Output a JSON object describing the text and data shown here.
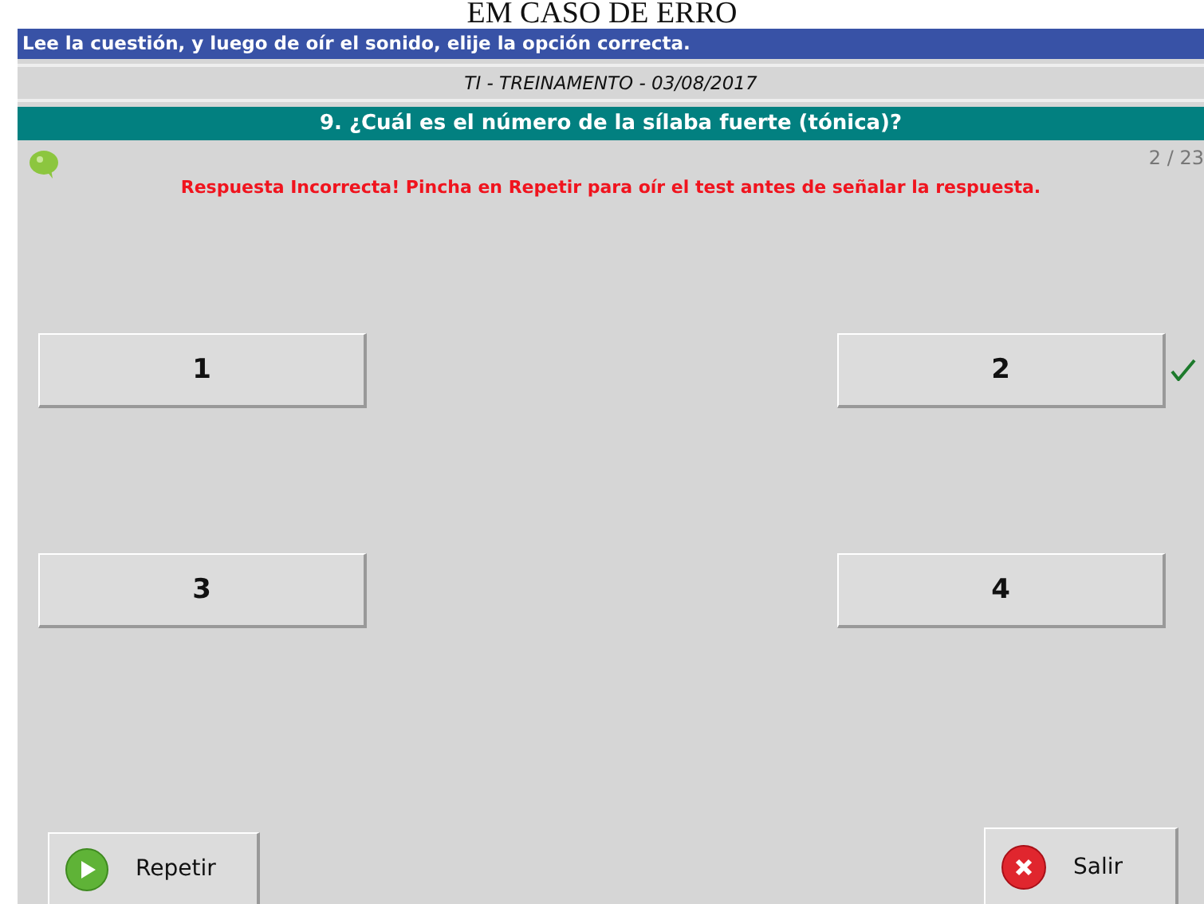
{
  "caption": "EM CASO DE ERRO",
  "instruction_bar": "Lee la cuestión, y luego de oír el sonido, elije la opción correcta.",
  "session_title": "TI - TREINAMENTO - 03/08/2017",
  "question_title": "9. ¿Cuál es el número de la sílaba fuerte (tónica)?",
  "progress": "2 / 23",
  "feedback": "Respuesta Incorrecta!  Pincha en Repetir para oír el test antes de señalar la respuesta.",
  "options": [
    {
      "label": "1",
      "correct": false
    },
    {
      "label": "2",
      "correct": true
    },
    {
      "label": "3",
      "correct": false
    },
    {
      "label": "4",
      "correct": false
    }
  ],
  "buttons": [
    {
      "kind": "repeat",
      "label": "Repetir"
    },
    {
      "kind": "exit",
      "label": "Salir"
    }
  ]
}
